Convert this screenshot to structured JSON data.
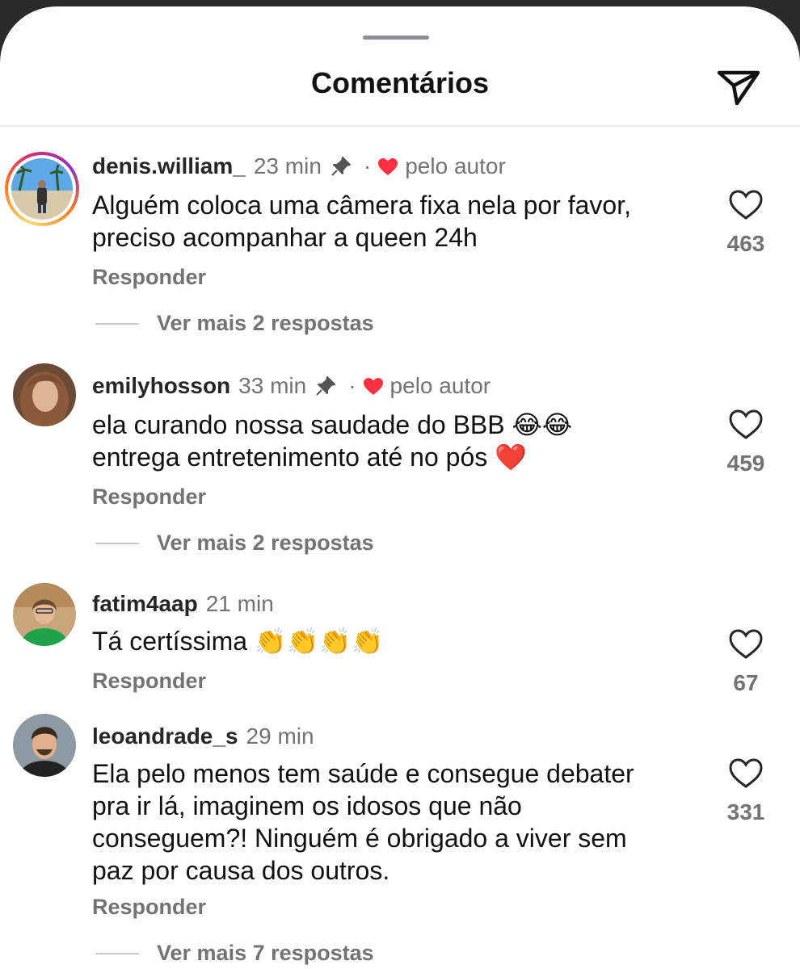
{
  "header": {
    "title": "Comentários",
    "share_icon": "paper-plane-icon"
  },
  "comments": [
    {
      "username": "denis.william_",
      "time": "23 min",
      "pinned": true,
      "dot": "·",
      "liked_by_author": "pelo autor",
      "text_line1": "Alguém coloca uma câmera fixa nela por favor,",
      "text_line2": "preciso acompanhar a queen 24h",
      "reply": "Responder",
      "more": "Ver mais 2 respostas",
      "likes": "463"
    },
    {
      "username": "emilyhosson",
      "time": "33 min",
      "pinned": true,
      "dot": "·",
      "liked_by_author": "pelo autor",
      "text_line1": "ela curando nossa saudade do BBB 😂😂",
      "text_line2": "entrega entretenimento até no pós ❤️",
      "reply": "Responder",
      "more": "Ver mais 2 respostas",
      "likes": "459"
    },
    {
      "username": "fatim4aap",
      "time": "21 min",
      "text_line1": "Tá certíssima 👏👏👏👏",
      "reply": "Responder",
      "likes": "67"
    },
    {
      "username": "leoandrade_s",
      "time": "29 min",
      "text_line1": "Ela pelo menos tem saúde e consegue debater",
      "text_line2": "pra ir lá, imaginem os idosos que não",
      "text_line3": "conseguem?! Ninguém é obrigado a viver sem",
      "text_line4": "paz por causa dos outros.",
      "reply": "Responder",
      "more": "Ver mais 7 respostas",
      "likes": "331"
    }
  ],
  "colors": {
    "heart_red": "#ff3040",
    "secondary_text": "#737373"
  }
}
